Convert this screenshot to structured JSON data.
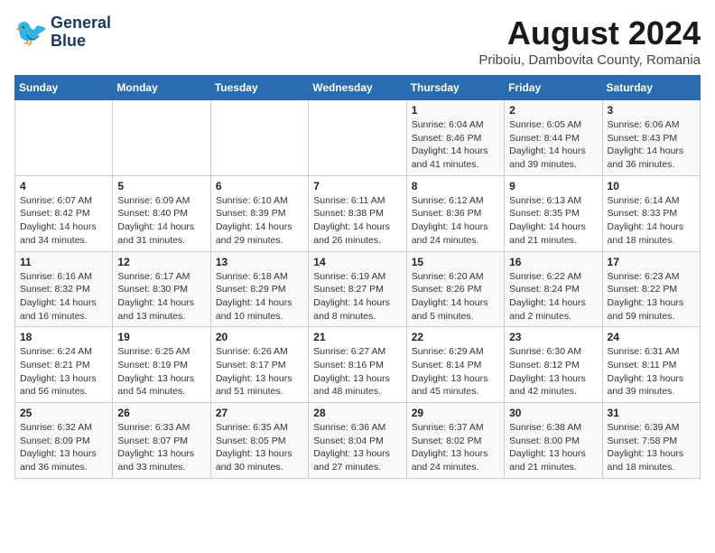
{
  "header": {
    "logo_line1": "General",
    "logo_line2": "Blue",
    "month_year": "August 2024",
    "location": "Priboiu, Dambovita County, Romania"
  },
  "weekdays": [
    "Sunday",
    "Monday",
    "Tuesday",
    "Wednesday",
    "Thursday",
    "Friday",
    "Saturday"
  ],
  "weeks": [
    [
      {
        "day": "",
        "info": ""
      },
      {
        "day": "",
        "info": ""
      },
      {
        "day": "",
        "info": ""
      },
      {
        "day": "",
        "info": ""
      },
      {
        "day": "1",
        "info": "Sunrise: 6:04 AM\nSunset: 8:46 PM\nDaylight: 14 hours\nand 41 minutes."
      },
      {
        "day": "2",
        "info": "Sunrise: 6:05 AM\nSunset: 8:44 PM\nDaylight: 14 hours\nand 39 minutes."
      },
      {
        "day": "3",
        "info": "Sunrise: 6:06 AM\nSunset: 8:43 PM\nDaylight: 14 hours\nand 36 minutes."
      }
    ],
    [
      {
        "day": "4",
        "info": "Sunrise: 6:07 AM\nSunset: 8:42 PM\nDaylight: 14 hours\nand 34 minutes."
      },
      {
        "day": "5",
        "info": "Sunrise: 6:09 AM\nSunset: 8:40 PM\nDaylight: 14 hours\nand 31 minutes."
      },
      {
        "day": "6",
        "info": "Sunrise: 6:10 AM\nSunset: 8:39 PM\nDaylight: 14 hours\nand 29 minutes."
      },
      {
        "day": "7",
        "info": "Sunrise: 6:11 AM\nSunset: 8:38 PM\nDaylight: 14 hours\nand 26 minutes."
      },
      {
        "day": "8",
        "info": "Sunrise: 6:12 AM\nSunset: 8:36 PM\nDaylight: 14 hours\nand 24 minutes."
      },
      {
        "day": "9",
        "info": "Sunrise: 6:13 AM\nSunset: 8:35 PM\nDaylight: 14 hours\nand 21 minutes."
      },
      {
        "day": "10",
        "info": "Sunrise: 6:14 AM\nSunset: 8:33 PM\nDaylight: 14 hours\nand 18 minutes."
      }
    ],
    [
      {
        "day": "11",
        "info": "Sunrise: 6:16 AM\nSunset: 8:32 PM\nDaylight: 14 hours\nand 16 minutes."
      },
      {
        "day": "12",
        "info": "Sunrise: 6:17 AM\nSunset: 8:30 PM\nDaylight: 14 hours\nand 13 minutes."
      },
      {
        "day": "13",
        "info": "Sunrise: 6:18 AM\nSunset: 8:29 PM\nDaylight: 14 hours\nand 10 minutes."
      },
      {
        "day": "14",
        "info": "Sunrise: 6:19 AM\nSunset: 8:27 PM\nDaylight: 14 hours\nand 8 minutes."
      },
      {
        "day": "15",
        "info": "Sunrise: 6:20 AM\nSunset: 8:26 PM\nDaylight: 14 hours\nand 5 minutes."
      },
      {
        "day": "16",
        "info": "Sunrise: 6:22 AM\nSunset: 8:24 PM\nDaylight: 14 hours\nand 2 minutes."
      },
      {
        "day": "17",
        "info": "Sunrise: 6:23 AM\nSunset: 8:22 PM\nDaylight: 13 hours\nand 59 minutes."
      }
    ],
    [
      {
        "day": "18",
        "info": "Sunrise: 6:24 AM\nSunset: 8:21 PM\nDaylight: 13 hours\nand 56 minutes."
      },
      {
        "day": "19",
        "info": "Sunrise: 6:25 AM\nSunset: 8:19 PM\nDaylight: 13 hours\nand 54 minutes."
      },
      {
        "day": "20",
        "info": "Sunrise: 6:26 AM\nSunset: 8:17 PM\nDaylight: 13 hours\nand 51 minutes."
      },
      {
        "day": "21",
        "info": "Sunrise: 6:27 AM\nSunset: 8:16 PM\nDaylight: 13 hours\nand 48 minutes."
      },
      {
        "day": "22",
        "info": "Sunrise: 6:29 AM\nSunset: 8:14 PM\nDaylight: 13 hours\nand 45 minutes."
      },
      {
        "day": "23",
        "info": "Sunrise: 6:30 AM\nSunset: 8:12 PM\nDaylight: 13 hours\nand 42 minutes."
      },
      {
        "day": "24",
        "info": "Sunrise: 6:31 AM\nSunset: 8:11 PM\nDaylight: 13 hours\nand 39 minutes."
      }
    ],
    [
      {
        "day": "25",
        "info": "Sunrise: 6:32 AM\nSunset: 8:09 PM\nDaylight: 13 hours\nand 36 minutes."
      },
      {
        "day": "26",
        "info": "Sunrise: 6:33 AM\nSunset: 8:07 PM\nDaylight: 13 hours\nand 33 minutes."
      },
      {
        "day": "27",
        "info": "Sunrise: 6:35 AM\nSunset: 8:05 PM\nDaylight: 13 hours\nand 30 minutes."
      },
      {
        "day": "28",
        "info": "Sunrise: 6:36 AM\nSunset: 8:04 PM\nDaylight: 13 hours\nand 27 minutes."
      },
      {
        "day": "29",
        "info": "Sunrise: 6:37 AM\nSunset: 8:02 PM\nDaylight: 13 hours\nand 24 minutes."
      },
      {
        "day": "30",
        "info": "Sunrise: 6:38 AM\nSunset: 8:00 PM\nDaylight: 13 hours\nand 21 minutes."
      },
      {
        "day": "31",
        "info": "Sunrise: 6:39 AM\nSunset: 7:58 PM\nDaylight: 13 hours\nand 18 minutes."
      }
    ]
  ]
}
